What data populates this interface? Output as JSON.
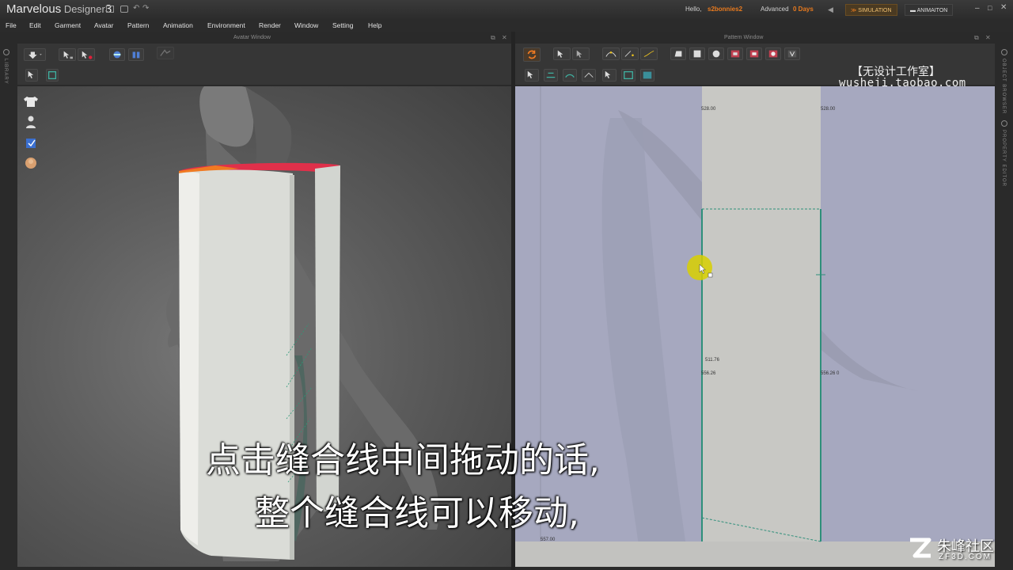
{
  "app": {
    "title_main": "Marvelous",
    "title_rest": " Designer",
    "version": "3"
  },
  "user": {
    "hello": "Hello,",
    "name": "s2bonnies2",
    "plan": "Advanced",
    "days": "0 Days"
  },
  "modes": {
    "simulation": "SIMULATION",
    "animation": "ANIMAITON"
  },
  "menu": [
    "File",
    "Edit",
    "Garment",
    "Avatar",
    "Pattern",
    "Animation",
    "Environment",
    "Render",
    "Window",
    "Setting",
    "Help"
  ],
  "windows": {
    "avatar": "Avatar Window",
    "pattern": "Pattern Window"
  },
  "side_labels": {
    "library": "LIBRARY",
    "object_browser": "OBJECT BROWSER",
    "property_editor": "PROPERTY EDITOR"
  },
  "watermark": {
    "studio": "【无设计工作室】",
    "url": "wusheji.taobao.com"
  },
  "measurements": {
    "top_left": "528.00",
    "top_right": "528.00",
    "seam_a": "511.76",
    "seam_b": "556.26",
    "seam_c": "556.26 0",
    "bottom": "557.00"
  },
  "subtitles": {
    "line1": "点击缝合线中间拖动的话,",
    "line2": "整个缝合线可以移动,"
  },
  "brand": {
    "name": "朱峰社区",
    "url": "ZF3D.COM"
  },
  "colors": {
    "accent": "#e87a1e",
    "seam": "#2e8f7a",
    "pattern_bg": "#a6a8bf",
    "panel": "#c7c7c4",
    "cursor": "#d8d000"
  },
  "icons": [
    "down-arrow-icon",
    "select-icon",
    "select-points-icon",
    "avatar-front-icon",
    "avatar-back-icon",
    "simulate-icon",
    "tshirt-icon",
    "avatar-body-icon",
    "cube-icon",
    "head-icon"
  ]
}
